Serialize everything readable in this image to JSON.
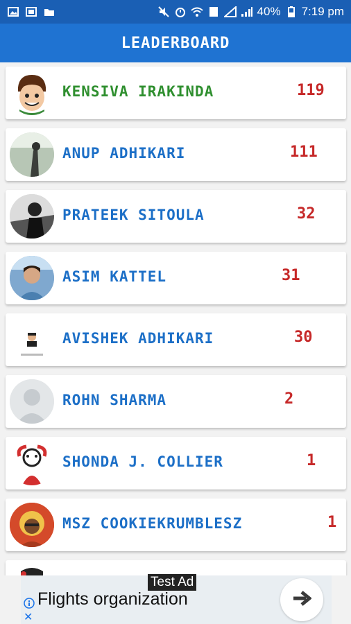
{
  "status_bar": {
    "battery": "40%",
    "time": "7:19 pm"
  },
  "header": {
    "title": "LEADERBOARD"
  },
  "leaderboard": [
    {
      "name": "KENSIVA IRAKINDA",
      "score": "119",
      "name_color": "#2f8f2f"
    },
    {
      "name": "ANUP ADHIKARI",
      "score": "111",
      "name_color": "#1c6fc7"
    },
    {
      "name": "PRATEEK SITOULA",
      "score": "32",
      "name_color": "#1c6fc7"
    },
    {
      "name": "ASIM KATTEL",
      "score": "31",
      "name_color": "#1c6fc7"
    },
    {
      "name": "AVISHEK ADHIKARI",
      "score": "30",
      "name_color": "#1c6fc7"
    },
    {
      "name": "ROHN SHARMA",
      "score": "2",
      "name_color": "#1c6fc7"
    },
    {
      "name": "SHONDA J. COLLIER",
      "score": "1",
      "name_color": "#1c6fc7"
    },
    {
      "name": "MSZ COOKIEKRUMBLESZ",
      "score": "1",
      "name_color": "#1c6fc7"
    }
  ],
  "ad": {
    "label": "Test Ad",
    "text": "Flights organization",
    "close": "✕"
  }
}
